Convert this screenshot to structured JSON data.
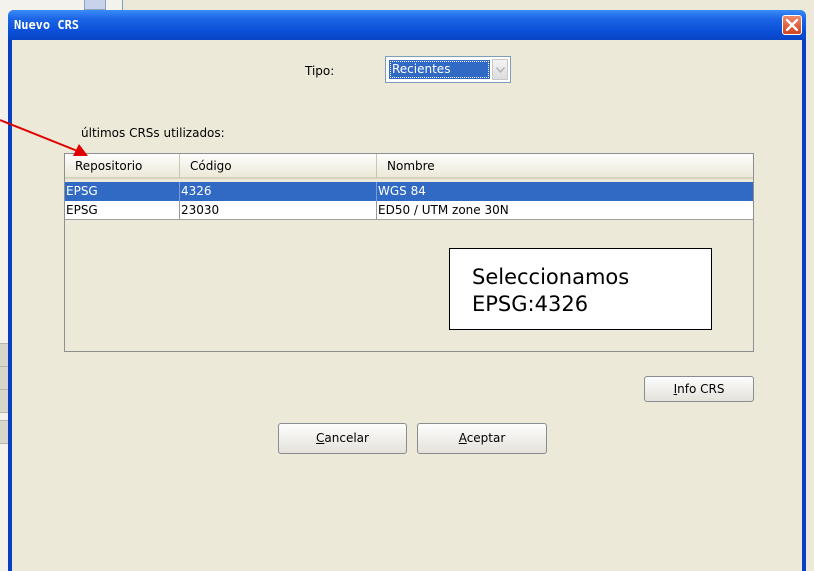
{
  "dialog": {
    "title": "Nuevo CRS",
    "tipo_label": "Tipo:",
    "tipo_value": "Recientes",
    "recent_label": "últimos CRSs utilizados:",
    "table": {
      "columns": [
        "Repositorio",
        "Código",
        "Nombre"
      ],
      "rows": [
        {
          "repo": "EPSG",
          "code": "4326",
          "name": "WGS 84",
          "selected": true
        },
        {
          "repo": "EPSG",
          "code": "23030",
          "name": "ED50 / UTM zone 30N",
          "selected": false
        }
      ]
    },
    "buttons": {
      "info_prefix": "I",
      "info_rest": "nfo CRS",
      "cancel_prefix": "C",
      "cancel_rest": "ancelar",
      "accept_prefix": "A",
      "accept_rest": "ceptar"
    }
  },
  "annotation": {
    "line1": "Seleccionamos",
    "line2": "EPSG:4326",
    "arrow_color": "#e00000"
  },
  "colors": {
    "title_bar": "#0a4fd8",
    "selection": "#316ac5",
    "dialog_bg": "#ece9d8"
  },
  "icons": {
    "close": "close-icon",
    "dropdown": "chevron-down-icon"
  }
}
